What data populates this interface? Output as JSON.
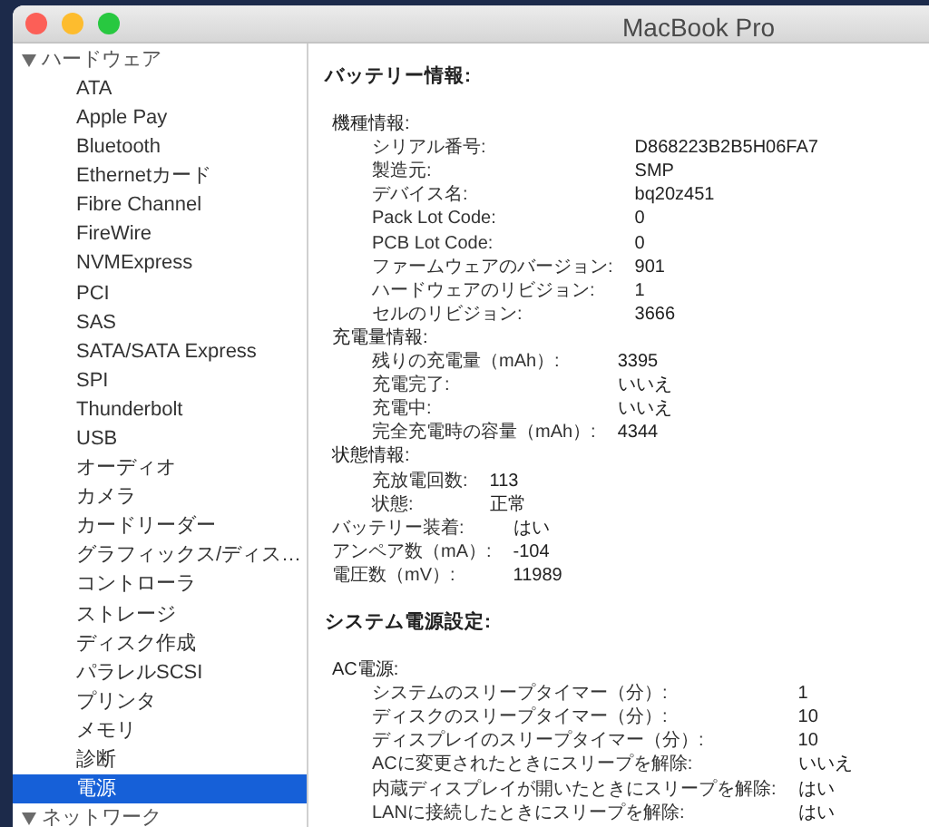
{
  "window": {
    "title": "MacBook Pro"
  },
  "sidebar": [
    {
      "label": "ハードウェア",
      "expanded": true,
      "children": [
        {
          "label": "ATA",
          "selected": false
        },
        {
          "label": "Apple Pay",
          "selected": false
        },
        {
          "label": "Bluetooth",
          "selected": false
        },
        {
          "label": "Ethernetカード",
          "selected": false
        },
        {
          "label": "Fibre Channel",
          "selected": false
        },
        {
          "label": "FireWire",
          "selected": false
        },
        {
          "label": "NVMExpress",
          "selected": false
        },
        {
          "label": "PCI",
          "selected": false
        },
        {
          "label": "SAS",
          "selected": false
        },
        {
          "label": "SATA/SATA Express",
          "selected": false
        },
        {
          "label": "SPI",
          "selected": false
        },
        {
          "label": "Thunderbolt",
          "selected": false
        },
        {
          "label": "USB",
          "selected": false
        },
        {
          "label": "オーディオ",
          "selected": false
        },
        {
          "label": "カメラ",
          "selected": false
        },
        {
          "label": "カードリーダー",
          "selected": false
        },
        {
          "label": "グラフィックス/ディス…",
          "selected": false
        },
        {
          "label": "コントローラ",
          "selected": false
        },
        {
          "label": "ストレージ",
          "selected": false
        },
        {
          "label": "ディスク作成",
          "selected": false
        },
        {
          "label": "パラレルSCSI",
          "selected": false
        },
        {
          "label": "プリンタ",
          "selected": false
        },
        {
          "label": "メモリ",
          "selected": false
        },
        {
          "label": "診断",
          "selected": false
        },
        {
          "label": "電源",
          "selected": true
        }
      ]
    },
    {
      "label": "ネットワーク",
      "expanded": true
    }
  ],
  "sections": [
    {
      "title": "バッテリー情報:",
      "groups": [
        {
          "title": "機種情報:",
          "rows": [
            {
              "label": "シリアル番号:",
              "value": "D868223B2B5H06FA7"
            },
            {
              "label": "製造元:",
              "value": "SMP"
            },
            {
              "label": "デバイス名:",
              "value": "bq20z451"
            },
            {
              "label": "Pack Lot Code:",
              "value": "0"
            },
            {
              "label": "PCB Lot Code:",
              "value": "0"
            },
            {
              "label": "ファームウェアのバージョン:",
              "value": "901"
            },
            {
              "label": "ハードウェアのリビジョン:",
              "value": "1"
            },
            {
              "label": "セルのリビジョン:",
              "value": "3666"
            }
          ]
        },
        {
          "title": "充電量情報:",
          "rows": [
            {
              "label": "残りの充電量（mAh）:",
              "value": "3395"
            },
            {
              "label": "充電完了:",
              "value": "いいえ"
            },
            {
              "label": "充電中:",
              "value": "いいえ"
            },
            {
              "label": "完全充電時の容量（mAh）:",
              "value": "4344"
            }
          ]
        },
        {
          "title": "状態情報:",
          "rows": [
            {
              "label": "充放電回数:",
              "value": "113"
            },
            {
              "label": "状態:",
              "value": "正常"
            }
          ]
        },
        {
          "rows": [
            {
              "label": "バッテリー装着:",
              "value": "はい"
            },
            {
              "label": "アンペア数（mA）:",
              "value": "-104"
            },
            {
              "label": "電圧数（mV）:",
              "value": "11989"
            }
          ]
        }
      ]
    },
    {
      "title": "システム電源設定:",
      "groups": [
        {
          "title": "AC電源:",
          "rows": [
            {
              "label": "システムのスリープタイマー（分）:",
              "value": "1"
            },
            {
              "label": "ディスクのスリープタイマー（分）:",
              "value": "10"
            },
            {
              "label": "ディスプレイのスリープタイマー（分）:",
              "value": "10"
            },
            {
              "label": "ACに変更されたときにスリープを解除:",
              "value": "いいえ"
            },
            {
              "label": "内蔵ディスプレイが開いたときにスリープを解除:",
              "value": "はい"
            },
            {
              "label": "LANに接続したときにスリープを解除:",
              "value": "はい"
            }
          ]
        }
      ]
    }
  ]
}
